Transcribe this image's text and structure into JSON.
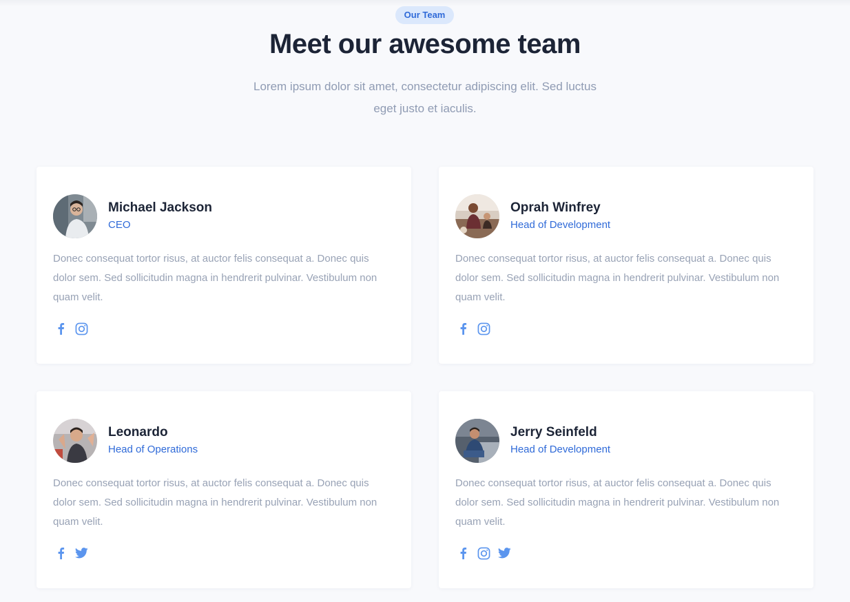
{
  "header": {
    "badge": "Our Team",
    "title": "Meet our awesome team",
    "subtitle": "Lorem ipsum dolor sit amet, consectetur adipiscing elit. Sed luctus eget justo et iaculis."
  },
  "colors": {
    "accent": "#2f6ad8",
    "icon": "#5b95ee",
    "heading": "#1c2436",
    "muted": "#98a2b5",
    "badge_bg": "#dbe8fc"
  },
  "team": [
    {
      "name": "Michael Jackson",
      "role": "CEO",
      "bio": "Donec consequat tortor risus, at auctor felis consequat a. Donec quis dolor sem. Sed sollicitudin magna in hendrerit pulvinar. Vestibulum non quam velit.",
      "socials": [
        "facebook-icon",
        "instagram-icon"
      ]
    },
    {
      "name": "Oprah Winfrey",
      "role": "Head of Development",
      "bio": "Donec consequat tortor risus, at auctor felis consequat a. Donec quis dolor sem. Sed sollicitudin magna in hendrerit pulvinar. Vestibulum non quam velit.",
      "socials": [
        "facebook-icon",
        "instagram-icon"
      ]
    },
    {
      "name": "Leonardo",
      "role": "Head of Operations",
      "bio": "Donec consequat tortor risus, at auctor felis consequat a. Donec quis dolor sem. Sed sollicitudin magna in hendrerit pulvinar. Vestibulum non quam velit.",
      "socials": [
        "facebook-icon",
        "twitter-icon"
      ]
    },
    {
      "name": "Jerry Seinfeld",
      "role": "Head of Development",
      "bio": "Donec consequat tortor risus, at auctor felis consequat a. Donec quis dolor sem. Sed sollicitudin magna in hendrerit pulvinar. Vestibulum non quam velit.",
      "socials": [
        "facebook-icon",
        "instagram-icon",
        "twitter-icon"
      ]
    }
  ]
}
